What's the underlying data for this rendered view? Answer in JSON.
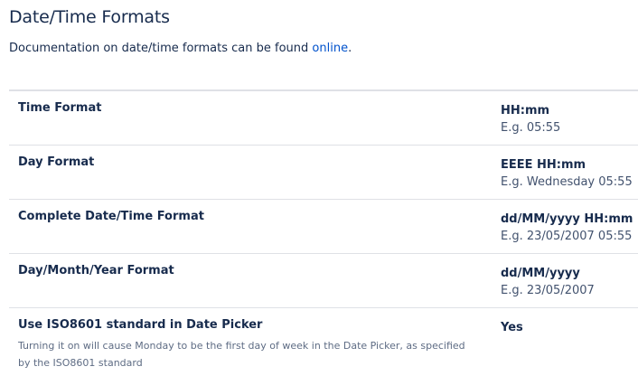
{
  "page": {
    "title": "Date/Time Formats",
    "intro_text": "Documentation on date/time formats can be found ",
    "intro_link": "online",
    "intro_end": "."
  },
  "settings": [
    {
      "label": "Time Format",
      "value": "HH:mm",
      "example": "E.g. 05:55"
    },
    {
      "label": "Day Format",
      "value": "EEEE HH:mm",
      "example": "E.g. Wednesday 05:55"
    },
    {
      "label": "Complete Date/Time Format",
      "value": "dd/MM/yyyy HH:mm",
      "example": "E.g. 23/05/2007 05:55"
    },
    {
      "label": "Day/Month/Year Format",
      "value": "dd/MM/yyyy",
      "example": "E.g. 23/05/2007"
    },
    {
      "label": "Use ISO8601 standard in Date Picker",
      "value": "Yes",
      "description": "Turning it on will cause Monday to be the first day of week in the Date Picker, as specified by the ISO8601 standard"
    }
  ],
  "colors": {
    "text": "#172b4d",
    "link": "#0052cc",
    "border": "#dfe1e6",
    "muted": "#5e6c84"
  }
}
